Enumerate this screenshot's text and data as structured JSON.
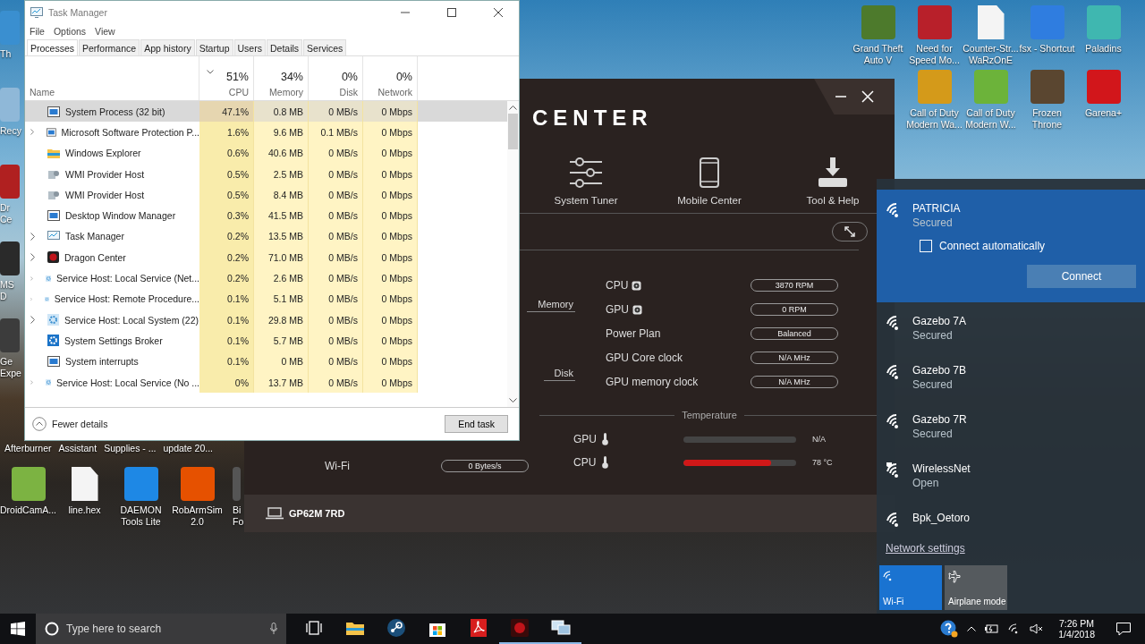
{
  "desktop": {
    "right_icons": [
      {
        "label": [
          "Grand Theft",
          "Auto V"
        ],
        "kind": "tile",
        "color": "#4d7a2c"
      },
      {
        "label": [
          "Need for",
          "Speed Mo..."
        ],
        "kind": "tile",
        "color": "#b8202a"
      },
      {
        "label": [
          "Counter-Str...",
          "WaRzOnE"
        ],
        "kind": "file",
        "color": "#f4f4f4"
      },
      {
        "label": [
          "fsx - Shortcut"
        ],
        "kind": "tile",
        "color": "#2f7de0"
      },
      {
        "label": [
          "Paladins"
        ],
        "kind": "tile",
        "color": "#3fb7b0"
      },
      {
        "label": [
          "Call of Duty",
          "Modern Wa..."
        ],
        "kind": "tile",
        "color": "#d49a1a"
      },
      {
        "label": [
          "Call of Duty",
          "Modern W..."
        ],
        "kind": "tile",
        "color": "#6cb33a"
      },
      {
        "label": [
          "Frozen",
          "Throne"
        ],
        "kind": "tile",
        "color": "#5a4630"
      },
      {
        "label": [
          "Garena+"
        ],
        "kind": "tile",
        "color": "#d2161b"
      }
    ],
    "left_icons": [
      {
        "label": [
          "Th"
        ],
        "kind": "tile",
        "color": "#3a8fd0"
      },
      {
        "label": [
          "Recy"
        ],
        "kind": "tile",
        "color": "#8fb8d8"
      },
      {
        "label": [
          "Dr",
          "Ce"
        ],
        "kind": "tile",
        "color": "#b02020"
      },
      {
        "label": [
          "MS",
          "D"
        ],
        "kind": "tile",
        "color": "#2a2a2a"
      },
      {
        "label": [
          "Ge",
          "Expe"
        ],
        "kind": "tile",
        "color": "#3c3c3c"
      }
    ],
    "middle_labels": [
      "Afterburner",
      "Assistant",
      "Supplies - ...",
      "update 20..."
    ],
    "bottom_icons": [
      {
        "label": [
          "DroidCamA..."
        ],
        "kind": "tile",
        "color": "#7cb342"
      },
      {
        "label": [
          "line.hex"
        ],
        "kind": "file",
        "color": "#f4f4f4"
      },
      {
        "label": [
          "DAEMON",
          "Tools Lite"
        ],
        "kind": "tile",
        "color": "#1e88e5"
      },
      {
        "label": [
          "RobArmSim",
          "2.0"
        ],
        "kind": "tile",
        "color": "#e65100"
      },
      {
        "label": [
          "Bi",
          "Fo"
        ],
        "kind": "cut",
        "color": "#555555"
      }
    ]
  },
  "task_manager": {
    "title": "Task Manager",
    "menu": [
      "File",
      "Options",
      "View"
    ],
    "tabs": [
      {
        "label": "Processes",
        "selected": true
      },
      {
        "label": "Performance",
        "selected": false
      },
      {
        "label": "App history",
        "selected": false
      },
      {
        "label": "Startup",
        "selected": false
      },
      {
        "label": "Users",
        "selected": false
      },
      {
        "label": "Details",
        "selected": false
      },
      {
        "label": "Services",
        "selected": false
      }
    ],
    "columns": [
      {
        "name": "Name",
        "sorted": false
      },
      {
        "percent": "51%",
        "name": "CPU",
        "sorted": true
      },
      {
        "percent": "34%",
        "name": "Memory",
        "sorted": false
      },
      {
        "percent": "0%",
        "name": "Disk",
        "sorted": false
      },
      {
        "percent": "0%",
        "name": "Network",
        "sorted": false
      }
    ],
    "rows": [
      {
        "name": "System Process (32 bit)",
        "kind": "app",
        "expandable": false,
        "selected": true,
        "cpu": "47.1%",
        "memory": "0.8 MB",
        "disk": "0 MB/s",
        "network": "0 Mbps"
      },
      {
        "name": "Microsoft Software Protection P...",
        "kind": "app",
        "expandable": true,
        "selected": false,
        "cpu": "1.6%",
        "memory": "9.6 MB",
        "disk": "0.1 MB/s",
        "network": "0 Mbps"
      },
      {
        "name": "Windows Explorer",
        "kind": "folder",
        "expandable": false,
        "selected": false,
        "cpu": "0.6%",
        "memory": "40.6 MB",
        "disk": "0 MB/s",
        "network": "0 Mbps"
      },
      {
        "name": "WMI Provider Host",
        "kind": "wmi",
        "expandable": false,
        "selected": false,
        "cpu": "0.5%",
        "memory": "2.5 MB",
        "disk": "0 MB/s",
        "network": "0 Mbps"
      },
      {
        "name": "WMI Provider Host",
        "kind": "wmi",
        "expandable": false,
        "selected": false,
        "cpu": "0.5%",
        "memory": "8.4 MB",
        "disk": "0 MB/s",
        "network": "0 Mbps"
      },
      {
        "name": "Desktop Window Manager",
        "kind": "app",
        "expandable": false,
        "selected": false,
        "cpu": "0.3%",
        "memory": "41.5 MB",
        "disk": "0 MB/s",
        "network": "0 Mbps"
      },
      {
        "name": "Task Manager",
        "kind": "monitor",
        "expandable": true,
        "selected": false,
        "cpu": "0.2%",
        "memory": "13.5 MB",
        "disk": "0 MB/s",
        "network": "0 Mbps"
      },
      {
        "name": "Dragon Center",
        "kind": "dragon",
        "expandable": true,
        "selected": false,
        "cpu": "0.2%",
        "memory": "71.0 MB",
        "disk": "0 MB/s",
        "network": "0 Mbps"
      },
      {
        "name": "Service Host: Local Service (Net...",
        "kind": "service",
        "expandable": true,
        "selected": false,
        "cpu": "0.2%",
        "memory": "2.6 MB",
        "disk": "0 MB/s",
        "network": "0 Mbps"
      },
      {
        "name": "Service Host: Remote Procedure...",
        "kind": "service",
        "expandable": true,
        "selected": false,
        "cpu": "0.1%",
        "memory": "5.1 MB",
        "disk": "0 MB/s",
        "network": "0 Mbps"
      },
      {
        "name": "Service Host: Local System (22)",
        "kind": "service",
        "expandable": true,
        "selected": false,
        "cpu": "0.1%",
        "memory": "29.8 MB",
        "disk": "0 MB/s",
        "network": "0 Mbps"
      },
      {
        "name": "System Settings Broker",
        "kind": "settings",
        "expandable": false,
        "selected": false,
        "cpu": "0.1%",
        "memory": "5.7 MB",
        "disk": "0 MB/s",
        "network": "0 Mbps"
      },
      {
        "name": "System interrupts",
        "kind": "app",
        "expandable": false,
        "selected": false,
        "cpu": "0.1%",
        "memory": "0 MB",
        "disk": "0 MB/s",
        "network": "0 Mbps"
      },
      {
        "name": "Service Host: Local Service (No ...",
        "kind": "service",
        "expandable": true,
        "selected": false,
        "cpu": "0%",
        "memory": "13.7 MB",
        "disk": "0 MB/s",
        "network": "0 Mbps"
      }
    ],
    "fewer_details": "Fewer details",
    "end_task": "End task"
  },
  "dragon_center": {
    "logo": "CENTER",
    "nav": [
      {
        "label": "System Tuner",
        "kind": "sliders"
      },
      {
        "label": "Mobile Center",
        "kind": "phone"
      },
      {
        "label": "Tool & Help",
        "kind": "download"
      }
    ],
    "side_labels": [
      "Memory",
      "Disk"
    ],
    "params": [
      {
        "label": "CPU",
        "fan": true,
        "value": "3870 RPM"
      },
      {
        "label": "GPU",
        "fan": true,
        "value": "0 RPM"
      },
      {
        "label": "Power Plan",
        "fan": false,
        "value": "Balanced"
      },
      {
        "label": "GPU Core clock",
        "fan": false,
        "value": "N/A MHz"
      },
      {
        "label": "GPU memory clock",
        "fan": false,
        "value": "N/A MHz"
      }
    ],
    "temperature": {
      "title": "Temperature",
      "rows": [
        {
          "label": "GPU",
          "level": 0,
          "reading": "N/A"
        },
        {
          "label": "CPU",
          "level": 0.78,
          "reading": "78 °C"
        }
      ]
    },
    "network": [
      {
        "label": "Wi-Fi",
        "value": "0 Bytes/s"
      }
    ],
    "model": "GP62M 7RD"
  },
  "wifi_panel": {
    "networks": [
      {
        "name": "PATRICIA",
        "status": "Secured",
        "selected": true,
        "warning": false
      },
      {
        "name": "Gazebo 7A",
        "status": "Secured",
        "selected": false,
        "warning": false
      },
      {
        "name": "Gazebo 7B",
        "status": "Secured",
        "selected": false,
        "warning": false
      },
      {
        "name": "Gazebo 7R",
        "status": "Secured",
        "selected": false,
        "warning": false
      },
      {
        "name": "WirelessNet",
        "status": "Open",
        "selected": false,
        "warning": true
      },
      {
        "name": "Bpk_Oetoro",
        "selected": false,
        "warning": false
      }
    ],
    "connect_automatically": {
      "label": "Connect automatically",
      "checked": false
    },
    "connect_button": "Connect",
    "settings_link": "Network settings",
    "quick_actions": [
      {
        "label": "Wi-Fi",
        "kind": "wifi",
        "on": true
      },
      {
        "label": "Airplane mode",
        "kind": "airplane",
        "on": false
      }
    ]
  },
  "taskbar": {
    "search_placeholder": "Type here to search",
    "apps": [
      {
        "kind": "task-view",
        "running": false
      },
      {
        "kind": "folder",
        "running": false
      },
      {
        "kind": "steam",
        "running": false
      },
      {
        "kind": "store",
        "running": false
      },
      {
        "kind": "pdf",
        "running": false
      },
      {
        "kind": "dragon",
        "running": true
      },
      {
        "kind": "remote",
        "running": true
      }
    ],
    "time": "7:26 PM",
    "date": "1/4/2018"
  }
}
